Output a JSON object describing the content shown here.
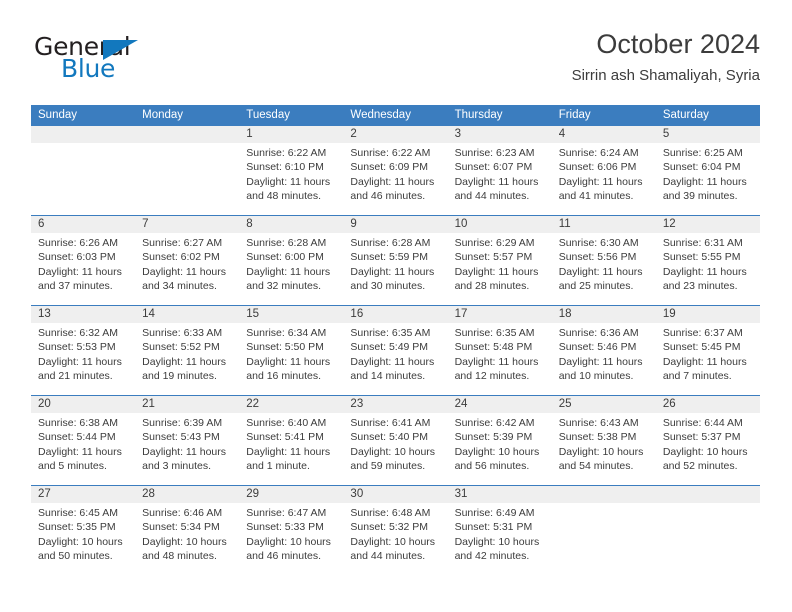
{
  "brand": {
    "name_part1": "General",
    "name_part2": "Blue",
    "accent_color": "#1278be"
  },
  "header": {
    "title": "October 2024",
    "subtitle": "Sirrin ash Shamaliyah, Syria"
  },
  "theme": {
    "header_band": "#3b7dbf",
    "number_band": "#efefef",
    "text": "#3c3c3c"
  },
  "weekdays": [
    "Sunday",
    "Monday",
    "Tuesday",
    "Wednesday",
    "Thursday",
    "Friday",
    "Saturday"
  ],
  "weeks": [
    [
      {
        "day": "",
        "sunrise": "",
        "sunset": "",
        "daylight": ""
      },
      {
        "day": "",
        "sunrise": "",
        "sunset": "",
        "daylight": ""
      },
      {
        "day": "1",
        "sunrise": "Sunrise: 6:22 AM",
        "sunset": "Sunset: 6:10 PM",
        "daylight": "Daylight: 11 hours and 48 minutes."
      },
      {
        "day": "2",
        "sunrise": "Sunrise: 6:22 AM",
        "sunset": "Sunset: 6:09 PM",
        "daylight": "Daylight: 11 hours and 46 minutes."
      },
      {
        "day": "3",
        "sunrise": "Sunrise: 6:23 AM",
        "sunset": "Sunset: 6:07 PM",
        "daylight": "Daylight: 11 hours and 44 minutes."
      },
      {
        "day": "4",
        "sunrise": "Sunrise: 6:24 AM",
        "sunset": "Sunset: 6:06 PM",
        "daylight": "Daylight: 11 hours and 41 minutes."
      },
      {
        "day": "5",
        "sunrise": "Sunrise: 6:25 AM",
        "sunset": "Sunset: 6:04 PM",
        "daylight": "Daylight: 11 hours and 39 minutes."
      }
    ],
    [
      {
        "day": "6",
        "sunrise": "Sunrise: 6:26 AM",
        "sunset": "Sunset: 6:03 PM",
        "daylight": "Daylight: 11 hours and 37 minutes."
      },
      {
        "day": "7",
        "sunrise": "Sunrise: 6:27 AM",
        "sunset": "Sunset: 6:02 PM",
        "daylight": "Daylight: 11 hours and 34 minutes."
      },
      {
        "day": "8",
        "sunrise": "Sunrise: 6:28 AM",
        "sunset": "Sunset: 6:00 PM",
        "daylight": "Daylight: 11 hours and 32 minutes."
      },
      {
        "day": "9",
        "sunrise": "Sunrise: 6:28 AM",
        "sunset": "Sunset: 5:59 PM",
        "daylight": "Daylight: 11 hours and 30 minutes."
      },
      {
        "day": "10",
        "sunrise": "Sunrise: 6:29 AM",
        "sunset": "Sunset: 5:57 PM",
        "daylight": "Daylight: 11 hours and 28 minutes."
      },
      {
        "day": "11",
        "sunrise": "Sunrise: 6:30 AM",
        "sunset": "Sunset: 5:56 PM",
        "daylight": "Daylight: 11 hours and 25 minutes."
      },
      {
        "day": "12",
        "sunrise": "Sunrise: 6:31 AM",
        "sunset": "Sunset: 5:55 PM",
        "daylight": "Daylight: 11 hours and 23 minutes."
      }
    ],
    [
      {
        "day": "13",
        "sunrise": "Sunrise: 6:32 AM",
        "sunset": "Sunset: 5:53 PM",
        "daylight": "Daylight: 11 hours and 21 minutes."
      },
      {
        "day": "14",
        "sunrise": "Sunrise: 6:33 AM",
        "sunset": "Sunset: 5:52 PM",
        "daylight": "Daylight: 11 hours and 19 minutes."
      },
      {
        "day": "15",
        "sunrise": "Sunrise: 6:34 AM",
        "sunset": "Sunset: 5:50 PM",
        "daylight": "Daylight: 11 hours and 16 minutes."
      },
      {
        "day": "16",
        "sunrise": "Sunrise: 6:35 AM",
        "sunset": "Sunset: 5:49 PM",
        "daylight": "Daylight: 11 hours and 14 minutes."
      },
      {
        "day": "17",
        "sunrise": "Sunrise: 6:35 AM",
        "sunset": "Sunset: 5:48 PM",
        "daylight": "Daylight: 11 hours and 12 minutes."
      },
      {
        "day": "18",
        "sunrise": "Sunrise: 6:36 AM",
        "sunset": "Sunset: 5:46 PM",
        "daylight": "Daylight: 11 hours and 10 minutes."
      },
      {
        "day": "19",
        "sunrise": "Sunrise: 6:37 AM",
        "sunset": "Sunset: 5:45 PM",
        "daylight": "Daylight: 11 hours and 7 minutes."
      }
    ],
    [
      {
        "day": "20",
        "sunrise": "Sunrise: 6:38 AM",
        "sunset": "Sunset: 5:44 PM",
        "daylight": "Daylight: 11 hours and 5 minutes."
      },
      {
        "day": "21",
        "sunrise": "Sunrise: 6:39 AM",
        "sunset": "Sunset: 5:43 PM",
        "daylight": "Daylight: 11 hours and 3 minutes."
      },
      {
        "day": "22",
        "sunrise": "Sunrise: 6:40 AM",
        "sunset": "Sunset: 5:41 PM",
        "daylight": "Daylight: 11 hours and 1 minute."
      },
      {
        "day": "23",
        "sunrise": "Sunrise: 6:41 AM",
        "sunset": "Sunset: 5:40 PM",
        "daylight": "Daylight: 10 hours and 59 minutes."
      },
      {
        "day": "24",
        "sunrise": "Sunrise: 6:42 AM",
        "sunset": "Sunset: 5:39 PM",
        "daylight": "Daylight: 10 hours and 56 minutes."
      },
      {
        "day": "25",
        "sunrise": "Sunrise: 6:43 AM",
        "sunset": "Sunset: 5:38 PM",
        "daylight": "Daylight: 10 hours and 54 minutes."
      },
      {
        "day": "26",
        "sunrise": "Sunrise: 6:44 AM",
        "sunset": "Sunset: 5:37 PM",
        "daylight": "Daylight: 10 hours and 52 minutes."
      }
    ],
    [
      {
        "day": "27",
        "sunrise": "Sunrise: 6:45 AM",
        "sunset": "Sunset: 5:35 PM",
        "daylight": "Daylight: 10 hours and 50 minutes."
      },
      {
        "day": "28",
        "sunrise": "Sunrise: 6:46 AM",
        "sunset": "Sunset: 5:34 PM",
        "daylight": "Daylight: 10 hours and 48 minutes."
      },
      {
        "day": "29",
        "sunrise": "Sunrise: 6:47 AM",
        "sunset": "Sunset: 5:33 PM",
        "daylight": "Daylight: 10 hours and 46 minutes."
      },
      {
        "day": "30",
        "sunrise": "Sunrise: 6:48 AM",
        "sunset": "Sunset: 5:32 PM",
        "daylight": "Daylight: 10 hours and 44 minutes."
      },
      {
        "day": "31",
        "sunrise": "Sunrise: 6:49 AM",
        "sunset": "Sunset: 5:31 PM",
        "daylight": "Daylight: 10 hours and 42 minutes."
      },
      {
        "day": "",
        "sunrise": "",
        "sunset": "",
        "daylight": ""
      },
      {
        "day": "",
        "sunrise": "",
        "sunset": "",
        "daylight": ""
      }
    ]
  ]
}
